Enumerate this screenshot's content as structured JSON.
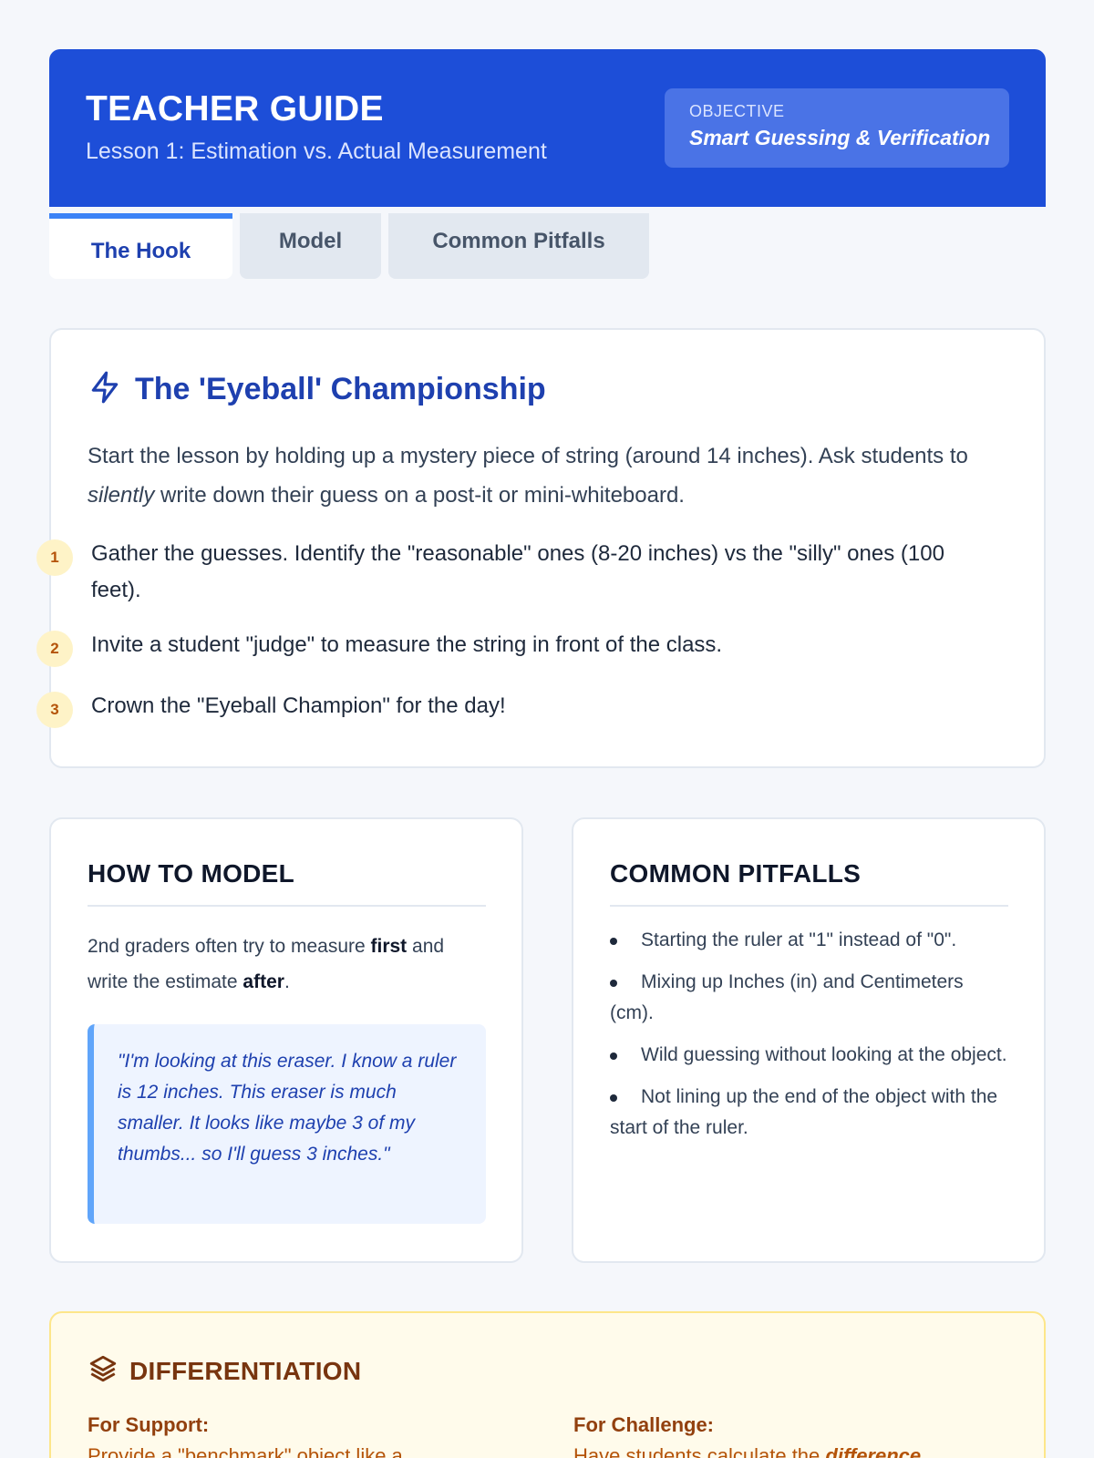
{
  "header": {
    "title": "TEACHER GUIDE",
    "subtitle": "Lesson 1: Estimation vs. Actual Measurement",
    "objective_label": "OBJECTIVE",
    "objective_value": "Smart Guessing & Verification",
    "background": "#1d4ed8"
  },
  "tabs": [
    {
      "label": "The Hook",
      "active": true
    },
    {
      "label": "Model",
      "active": false
    },
    {
      "label": "Common Pitfalls",
      "active": false
    }
  ],
  "hook": {
    "icon": "lightning-icon",
    "title": "The 'Eyeball' Championship",
    "intro_1": "Start the lesson by holding up a mystery piece of string (around 14 inches). Ask students to ",
    "intro_em": "silently",
    "intro_2": " write down their guess on a post-it or mini-whiteboard.",
    "steps": [
      {
        "num": "1",
        "text": "Gather the guesses. Identify the \"reasonable\" ones (8-20 inches) vs the \"silly\" ones (100 feet)."
      },
      {
        "num": "2",
        "text": "Invite a student \"judge\" to measure the string in front of the class."
      },
      {
        "num": "3",
        "text": "Crown the \"Eyeball Champion\" for the day!"
      }
    ]
  },
  "model": {
    "title": "HOW TO MODEL",
    "text_1": "2nd graders often try to measure ",
    "bold_1": "first",
    "text_2": " and write the estimate ",
    "bold_2": "after",
    "text_3": ".",
    "quote": "\"I'm looking at this eraser. I know a ruler is 12 inches. This eraser is much smaller. It looks like maybe 3 of my thumbs... so I'll guess 3 inches.\""
  },
  "pitfalls": {
    "title": "COMMON PITFALLS",
    "items": [
      "Starting the ruler at \"1\" instead of \"0\".",
      "Mixing up Inches (in) and Centimeters (cm).",
      "Wild guessing without looking at the object.",
      "Not lining up the end of the object with the start of the ruler."
    ]
  },
  "differentiation": {
    "icon": "layers-icon",
    "title": "DIFFERENTIATION",
    "support_label": "For Support:",
    "support_text": "Provide a \"benchmark\" object like a paperclip",
    "challenge_label": "For Challenge:",
    "challenge_text_1": "Have students calculate the ",
    "challenge_em": "difference"
  }
}
